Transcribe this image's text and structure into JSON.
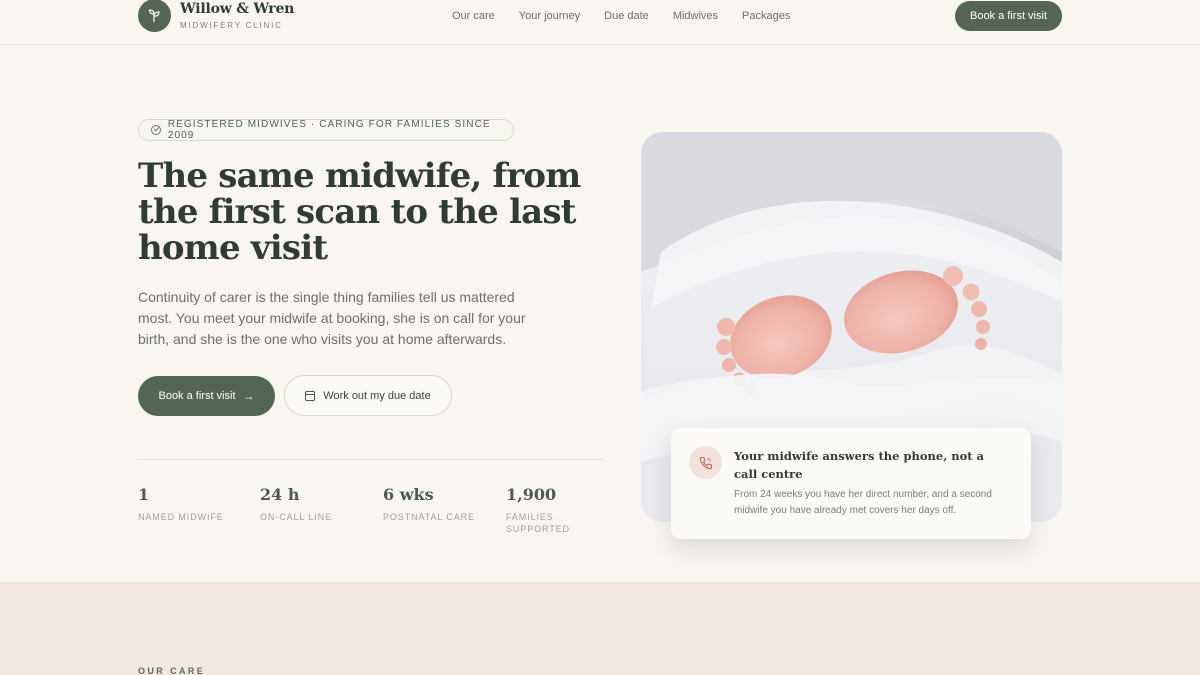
{
  "brand": {
    "name": "Willow & Wren",
    "subtitle": "MIDWIFERY CLINIC",
    "logo_icon": "sprout-icon"
  },
  "nav": {
    "items": [
      "Our care",
      "Your journey",
      "Due date",
      "Midwives",
      "Packages"
    ]
  },
  "header": {
    "cta_label": "Book a first visit"
  },
  "hero": {
    "badge": "REGISTERED MIDWIVES · CARING FOR FAMILIES SINCE 2009",
    "headline": "The same midwife, from the first scan to the last home visit",
    "lead": "Continuity of carer is the single thing families tell us mattered most. You meet your midwife at booking, she is on call for your birth, and she is the one who visits you at home afterwards.",
    "primary_cta": "Book a first visit",
    "primary_cta_icon": "arrow-right-icon",
    "secondary_cta": "Work out my due date",
    "secondary_cta_icon": "calendar-icon"
  },
  "stats": [
    {
      "value": "1",
      "label": "NAMED MIDWIFE"
    },
    {
      "value": "24 h",
      "label": "ON-CALL LINE"
    },
    {
      "value": "6 wks",
      "label": "POSTNATAL CARE"
    },
    {
      "value": "1,900",
      "label": "FAMILIES SUPPORTED"
    }
  ],
  "photo": {
    "subject": "baby-feet-in-blanket"
  },
  "card": {
    "icon": "phone-icon",
    "title": "Your midwife answers the phone, not a call centre",
    "text": "From 24 weeks you have her direct number, and a second midwife you have already met covers her days off."
  },
  "next_section": {
    "eyebrow": "OUR CARE"
  },
  "colors": {
    "background": "#f9f6f1",
    "primary": "#536655",
    "heading": "#2f3b34",
    "accent_soft": "#f3e1dc",
    "section_band": "#f0e8e1"
  }
}
